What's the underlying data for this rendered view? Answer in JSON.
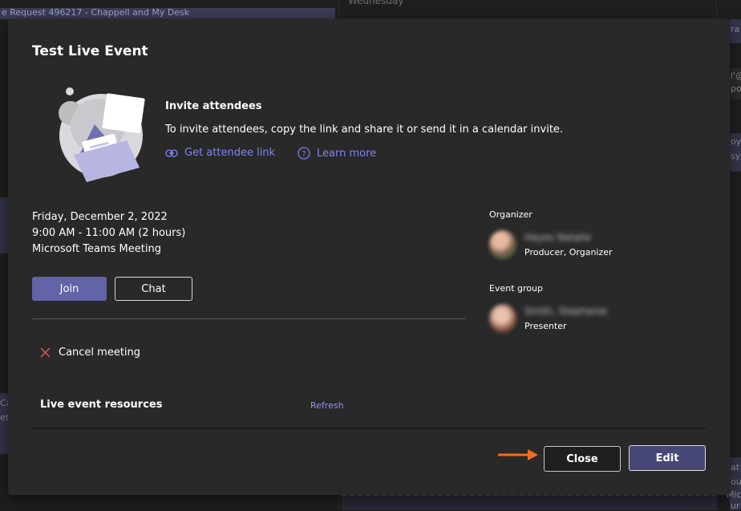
{
  "background": {
    "strip_text": "e Request 496217 - Chappell and My Desk",
    "day_header": "Wednesday",
    "fragments": [
      "ra",
      "l'@",
      "po",
      "oy",
      "sy",
      "Ca",
      "et",
      "at",
      "ou",
      "Mic",
      "ur"
    ]
  },
  "dialog": {
    "title": "Test Live Event",
    "invite": {
      "heading": "Invite attendees",
      "description": "To invite attendees, copy the link and share it or send it in a calendar invite.",
      "get_link_label": "Get attendee link",
      "learn_more_label": "Learn more"
    },
    "event": {
      "date": "Friday, December 2, 2022",
      "time": "9:00 AM - 11:00 AM (2 hours)",
      "type": "Microsoft Teams Meeting"
    },
    "buttons": {
      "join": "Join",
      "chat": "Chat",
      "cancel_meeting": "Cancel meeting",
      "close": "Close",
      "edit": "Edit"
    },
    "resources": {
      "heading": "Live event resources",
      "refresh": "Refresh"
    },
    "organizer": {
      "label": "Organizer",
      "name": "Hayes Natalie",
      "role": "Producer, Organizer"
    },
    "event_group": {
      "label": "Event group",
      "name": "Smith, Stephanie",
      "role": "Presenter"
    }
  },
  "colors": {
    "accent": "#6264a7",
    "link": "#7f85f5",
    "cancel_icon": "#e05a5a",
    "arrow": "#f26b21"
  }
}
